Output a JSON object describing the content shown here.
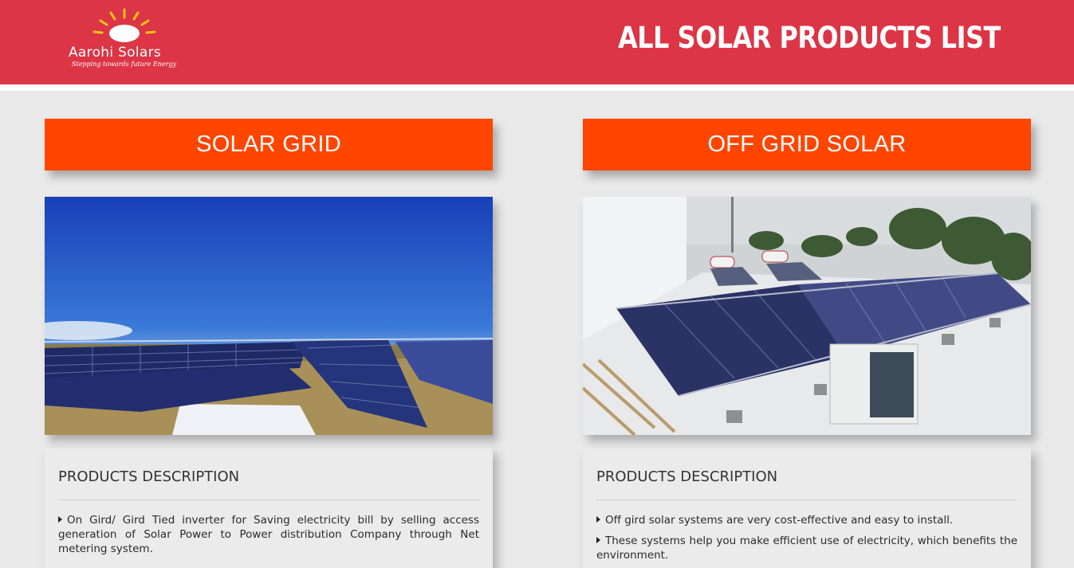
{
  "header": {
    "logo_name": "Aarohi Solars",
    "logo_tagline": "Stepping towards future Energy",
    "title": "ALL SOLAR PRODUCTS LIST"
  },
  "products": [
    {
      "name": "SOLAR GRID",
      "desc_title": "PRODUCTS DESCRIPTION",
      "items": [
        "On Gird/ Gird Tied inverter for Saving electricity bill by selling access generation of Solar Power to Power distribution Company through Net metering system."
      ]
    },
    {
      "name": "OFF GRID SOLAR",
      "desc_title": "PRODUCTS DESCRIPTION",
      "items": [
        "Off gird solar systems are very cost-effective and easy to install.",
        "These systems help you make efficient use of electricity, which benefits the environment."
      ]
    }
  ],
  "colors": {
    "header_bg": "#dc3545",
    "banner_bg": "#ff4500",
    "page_bg": "#e9e9e9"
  },
  "icons": [
    "sun-logo-icon",
    "caret-right-icon"
  ]
}
